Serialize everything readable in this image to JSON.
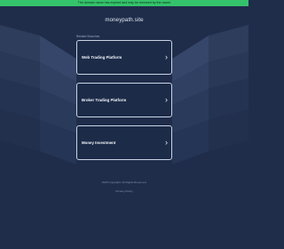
{
  "notice": "The domain name has expired and may be renewed by the owner",
  "domain": "moneypath.site",
  "related_label": "Related Searches",
  "links": [
    {
      "label": "Web Trading Platform"
    },
    {
      "label": "Broker Trading Platform"
    },
    {
      "label": "Money Investment"
    }
  ],
  "chevron": "›",
  "copyright": "2025 Copyright. All Rights Reserved.",
  "privacy": "Privacy Policy",
  "colors": {
    "background": "#1f2d4a",
    "notice_bar": "#34c36b",
    "card_border": "#c9d4e4"
  }
}
